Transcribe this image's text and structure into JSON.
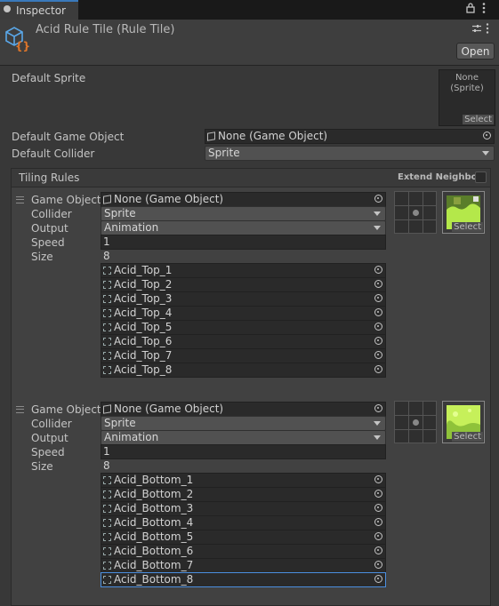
{
  "tab": {
    "title": "Inspector"
  },
  "header": {
    "title": "Acid Rule Tile (Rule Tile)",
    "open_label": "Open"
  },
  "default_sprite": {
    "label": "Default Sprite",
    "value_line1": "None",
    "value_line2": "(Sprite)",
    "select_label": "Select"
  },
  "default_game_object": {
    "label": "Default Game Object",
    "value": "None (Game Object)"
  },
  "default_collider": {
    "label": "Default Collider",
    "value": "Sprite"
  },
  "tiling": {
    "title": "Tiling Rules",
    "extend_neighbor": "Extend Neighbor",
    "rules": [
      {
        "game_object_label": "Game Object",
        "game_object": "None (Game Object)",
        "collider_label": "Collider",
        "collider": "Sprite",
        "output_label": "Output",
        "output": "Animation",
        "speed_label": "Speed",
        "speed": "1",
        "size_label": "Size",
        "size": "8",
        "sprites": [
          "Acid_Top_1",
          "Acid_Top_2",
          "Acid_Top_3",
          "Acid_Top_4",
          "Acid_Top_5",
          "Acid_Top_6",
          "Acid_Top_7",
          "Acid_Top_8"
        ],
        "select_label": "Select"
      },
      {
        "game_object_label": "Game Object",
        "game_object": "None (Game Object)",
        "collider_label": "Collider",
        "collider": "Sprite",
        "output_label": "Output",
        "output": "Animation",
        "speed_label": "Speed",
        "speed": "1",
        "size_label": "Size",
        "size": "8",
        "sprites": [
          "Acid_Bottom_1",
          "Acid_Bottom_2",
          "Acid_Bottom_3",
          "Acid_Bottom_4",
          "Acid_Bottom_5",
          "Acid_Bottom_6",
          "Acid_Bottom_7",
          "Acid_Bottom_8"
        ],
        "select_label": "Select"
      }
    ]
  },
  "colors": {
    "accent": "#3a79bb",
    "acid_green": "#b4e84a",
    "selected_outline": "#4b8fe0"
  }
}
